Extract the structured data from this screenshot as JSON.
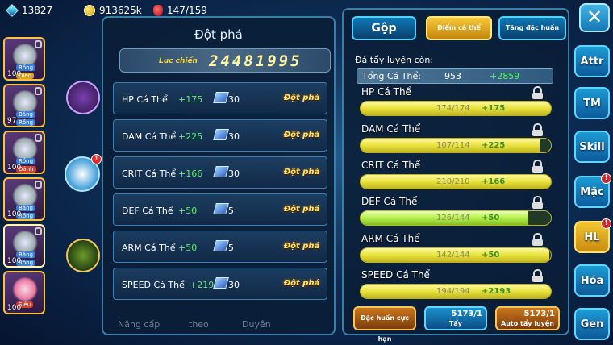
{
  "resources": {
    "gems": "13827",
    "gold": "913625k",
    "stamina": "147/159"
  },
  "team": [
    {
      "level": "100",
      "tag": "Rồng",
      "badge": "Điên"
    },
    {
      "level": "97",
      "tag": "Băng",
      "badge": "Rồng"
    },
    {
      "level": "100",
      "tag": "Rồng",
      "badge": "Đánh"
    },
    {
      "level": "100",
      "tag": "Băng",
      "badge": "Rồng"
    },
    {
      "level": "100",
      "tag": "Băng",
      "badge": "Rồng"
    },
    {
      "level": "100",
      "tag": "Siêu",
      "badge": ""
    }
  ],
  "breakthrough": {
    "title": "Đột phá",
    "power_label": "Lực chiến",
    "power_value": "24481995",
    "rows": [
      {
        "name": "HP Cá Thể",
        "bonus": "+175",
        "cost": "30",
        "button": "Đột phá"
      },
      {
        "name": "DAM Cá Thể",
        "bonus": "+225",
        "cost": "30",
        "button": "Đột phá"
      },
      {
        "name": "CRIT Cá Thể",
        "bonus": "+166",
        "cost": "30",
        "button": "Đột phá"
      },
      {
        "name": "DEF Cá Thể",
        "bonus": "+50",
        "cost": "5",
        "button": "Đột phá"
      },
      {
        "name": "ARM Cá Thể",
        "bonus": "+50",
        "cost": "5",
        "button": "Đột phá"
      },
      {
        "name": "SPEED Cá Thể",
        "bonus": "+2193",
        "cost": "30",
        "button": "Đột phá"
      }
    ],
    "bottom_nav": [
      "Nâng cấp",
      "theo",
      "Duyên"
    ]
  },
  "training": {
    "tabs": [
      "Gộp",
      "Điểm cá thể",
      "Tăng đặc huấn"
    ],
    "remaining_label": "Đá tẩy luyện còn:",
    "total_label": "Tổng Cá Thể:",
    "total_value": "953",
    "total_bonus": "+2859",
    "stats": [
      {
        "name": "HP Cá Thể",
        "value": "174/174",
        "bonus": "+175",
        "fill": 1.0
      },
      {
        "name": "DAM Cá Thể",
        "value": "107/114",
        "bonus": "+225",
        "fill": 0.94
      },
      {
        "name": "CRIT Cá Thể",
        "value": "210/210",
        "bonus": "+166",
        "fill": 1.0
      },
      {
        "name": "DEF Cá Thể",
        "value": "126/144",
        "bonus": "+50",
        "fill": 0.88
      },
      {
        "name": "ARM Cá Thể",
        "value": "142/144",
        "bonus": "+50",
        "fill": 0.99
      },
      {
        "name": "SPEED Cá Thể",
        "value": "194/194",
        "bonus": "+2193",
        "fill": 1.0
      }
    ],
    "actions": {
      "special": "Đặc huấn cực hạn",
      "wash_count": "5173/1",
      "wash_label": "Tẩy",
      "auto_count": "5173/1",
      "auto_label": "Auto tẩy luyện"
    }
  },
  "side_menu": [
    "Attr",
    "TM",
    "Skill",
    "Mặc",
    "HL",
    "Hóa",
    "Gen"
  ],
  "close_label": "✕"
}
